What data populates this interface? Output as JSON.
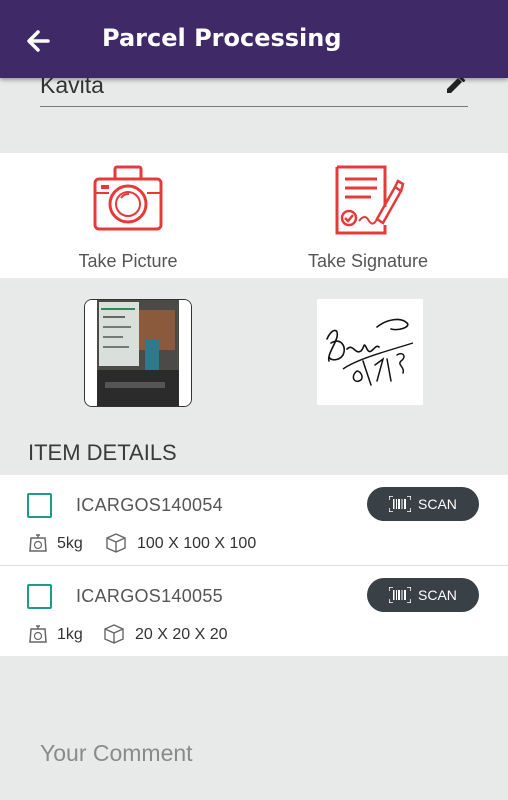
{
  "header": {
    "title": "Parcel Processing",
    "back_icon": "back-arrow-icon"
  },
  "name_field": {
    "value": "Kavita",
    "edit_icon": "pencil-icon"
  },
  "actions": {
    "take_picture_label": "Take Picture",
    "take_signature_label": "Take Signature",
    "accent_color": "#e8393a"
  },
  "item_details": {
    "title": "ITEM DETAILS",
    "items": [
      {
        "code": "ICARGOS140054",
        "weight": "5kg",
        "dimensions": "100 X 100 X 100",
        "scan_label": "SCAN"
      },
      {
        "code": "ICARGOS140055",
        "weight": "1kg",
        "dimensions": "20 X 20 X 20",
        "scan_label": "SCAN"
      }
    ]
  },
  "comment": {
    "placeholder": "Your Comment"
  },
  "colors": {
    "appbar": "#3f2a67",
    "checkbox": "#1f9a86",
    "scan_button": "#394046"
  }
}
